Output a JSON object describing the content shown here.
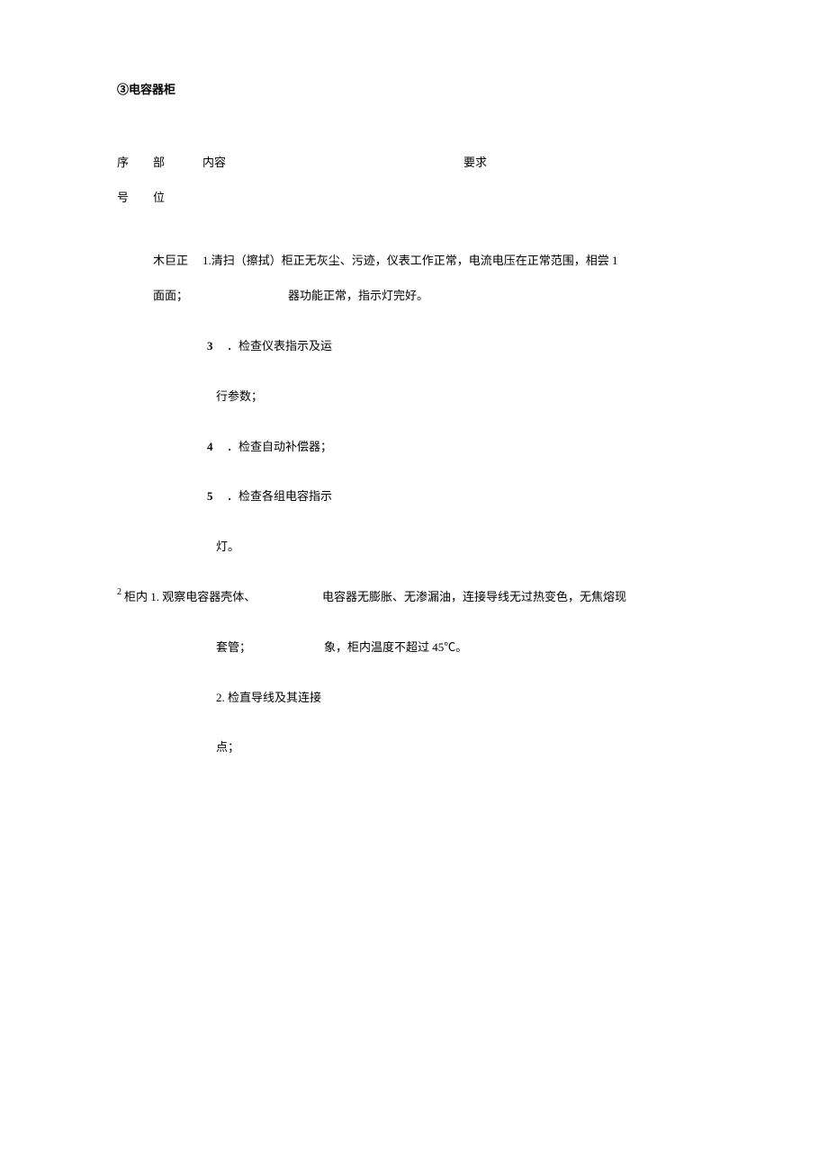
{
  "title": "③电容器柜",
  "headers": {
    "xu": "序",
    "bu": "部",
    "neirong": "内容",
    "yaoqiu": "要求",
    "hao": "号",
    "wei": "位"
  },
  "row1": {
    "buwei_a": "木巨正",
    "content_prefix": "1.",
    "content_a": "清扫（擦拭）柜正无灰尘、污迹，仪表工作正常，电流电压在正常范围，相尝 1",
    "buwei_b": "面面；",
    "requirement_b": "器功能正常，指示灯完好。",
    "item3_num": "3",
    "item3_text": "．检查仪表指示及运",
    "item3_cont": "行参数；",
    "item4_num": "4",
    "item4_text": "．检查自动补偿器；",
    "item5_num": "5",
    "item5_text": "．检查各组电容指示",
    "item5_cont": "灯。"
  },
  "row2": {
    "seq_sup": "2 ",
    "line1_left": "柜内 1. 观察电容器壳体、",
    "line1_right": "电容器无膨胀、无渗漏油，连接导线无过热变色，无焦熔现",
    "line2_left": "套管；",
    "line2_right": "象，柜内温度不超过 45℃。",
    "line3": "2. 检直导线及其连接",
    "line4": "点；"
  }
}
